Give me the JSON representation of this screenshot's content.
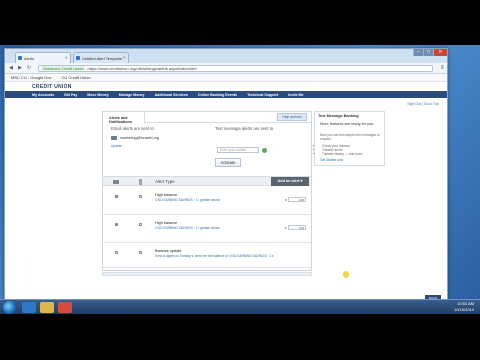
{
  "browser": {
    "tabs": [
      {
        "label": "Alerts",
        "active": true
      },
      {
        "label": "Untitled Alert Template",
        "active": false
      }
    ],
    "url_secure": "Goldenco Credit Union",
    "url": "https://www.creditunion.org/olb/settings/alerts.aspx#tab/eAlert",
    "bookmarks": [
      "MSC CU - Google Doc",
      "CU Credit Union"
    ]
  },
  "site": {
    "brand": "CREDIT UNION",
    "nav": [
      "My Accounts",
      "Bill Pay",
      "Move Money",
      "Manage Money",
      "Additional Services",
      "Online Banking Events",
      "Technical Support",
      "Invite Me"
    ],
    "signout": "Sign Out | Go to Top"
  },
  "panel": {
    "tab_label": "Alerts and Notifications",
    "help_label": "Help and Info",
    "email_label": "Email alerts are sent to",
    "email_value": "marketing@fcuweb.org",
    "email_update": "Update",
    "text_label": "Text message alerts are sent to",
    "phone_placeholder": "Enter your mobile",
    "activate_label": "Activate",
    "alert_type_header": "Alert Type",
    "add_alert_label": "Add an alert",
    "rows": [
      {
        "title": "High balance",
        "sub": "4 NO EARNING SAVINGS · 1 • greater above",
        "amount": "100",
        "currency": "$"
      },
      {
        "title": "High balance",
        "sub": "4 NO EARNING SAVINGS · 1 • greater above",
        "amount": "100",
        "currency": "$"
      },
      {
        "title": "Balance update",
        "sub": "Send a digest on Sunday ▾, send me the balance of 4 NO EARNING SAVINGS · 1 ▾",
        "amount": "",
        "currency": ""
      }
    ]
  },
  "sidebar": {
    "title": "Text Message Banking",
    "heading": "More features are ready for you.",
    "text": "Now you can text simple text messages to request:",
    "items": [
      "Check your balance",
      "Transfer funds",
      "Transfer history — and more"
    ],
    "link": "Get Started now"
  },
  "taskbar": {
    "time": "10:51 AM",
    "date": "10/15/2014"
  },
  "footer_logo": "NCUA",
  "colors": {
    "nav_bar": "#2d4b7a",
    "link": "#2c6fb5",
    "add_button": "#5d6670"
  }
}
